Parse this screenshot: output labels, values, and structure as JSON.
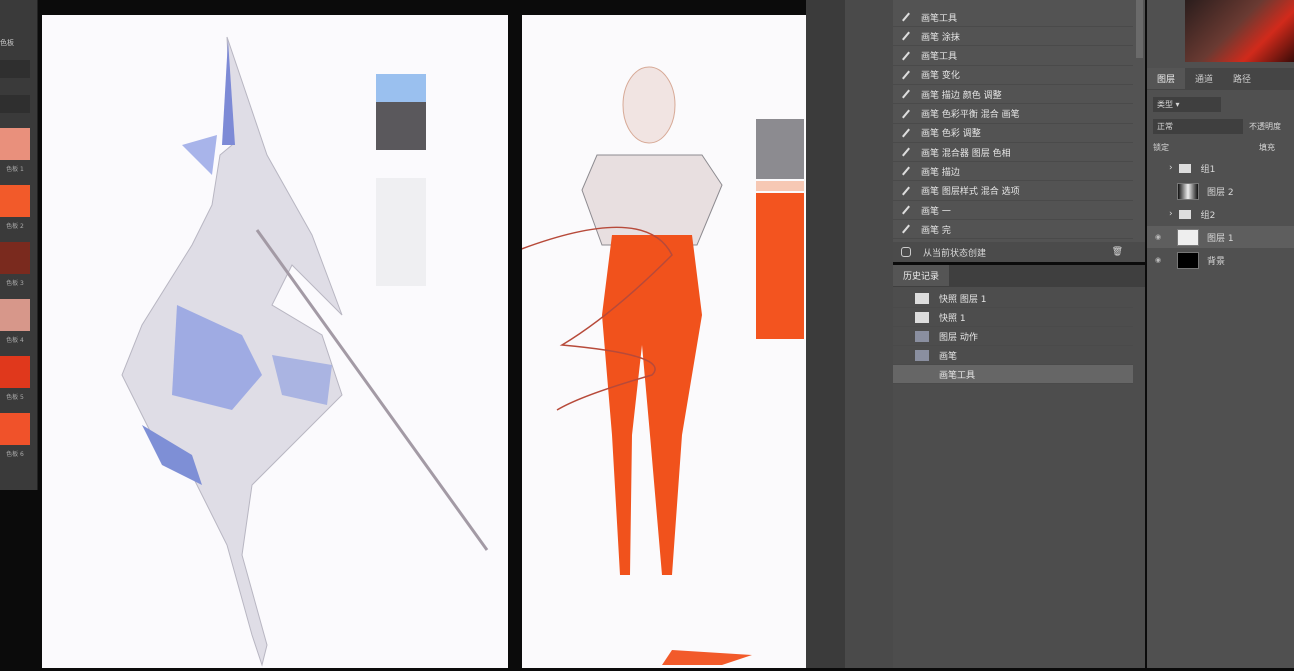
{
  "left_panel": {
    "title": "色板",
    "swatches": [
      {
        "color": "#e9907c",
        "label": "色板 1"
      },
      {
        "color": "#f25a2a",
        "label": "色板 2"
      },
      {
        "color": "#7a2a1e",
        "label": "色板 3"
      },
      {
        "color": "#d7978a",
        "label": "色板 4"
      },
      {
        "color": "#e0381c",
        "label": "色板 5"
      },
      {
        "color": "#f0522a",
        "label": "色板 6"
      }
    ]
  },
  "canvas1": {
    "swatches": [
      "#9ac0ef",
      "#5a585c",
      "#efeff2"
    ]
  },
  "canvas2": {
    "swatches": [
      "#8c8b90",
      "#f6c8b4",
      "#f3541f"
    ]
  },
  "history": {
    "items": [
      "画笔工具",
      "画笔 涂抹",
      "画笔工具",
      "画笔 变化",
      "画笔 描边 颜色 调整",
      "画笔 色彩平衡 混合 画笔",
      "画笔 色彩 调整",
      "画笔 混合器 图层 色相",
      "画笔 描边",
      "画笔 图层样式 混合 选项",
      "画笔 一",
      "画笔 完"
    ],
    "footer": "从当前状态创建"
  },
  "actions": {
    "tab": "历史记录",
    "items": [
      "快照 图层 1",
      "快照 1",
      "图层 动作",
      "画笔",
      "画笔工具"
    ]
  },
  "layers": {
    "tabs": [
      "图层",
      "通道",
      "路径"
    ],
    "kind_filter": "类型",
    "blend_mode": "正常",
    "opacity_label": "不透明度",
    "lock_label": "锁定",
    "fill_label": "填充",
    "items": [
      {
        "name": "组1",
        "type": "group"
      },
      {
        "name": "图层 2",
        "type": "layer"
      },
      {
        "name": "组2",
        "type": "group"
      },
      {
        "name": "图层 1",
        "type": "layer",
        "selected": true
      },
      {
        "name": "背景",
        "type": "background"
      }
    ]
  }
}
